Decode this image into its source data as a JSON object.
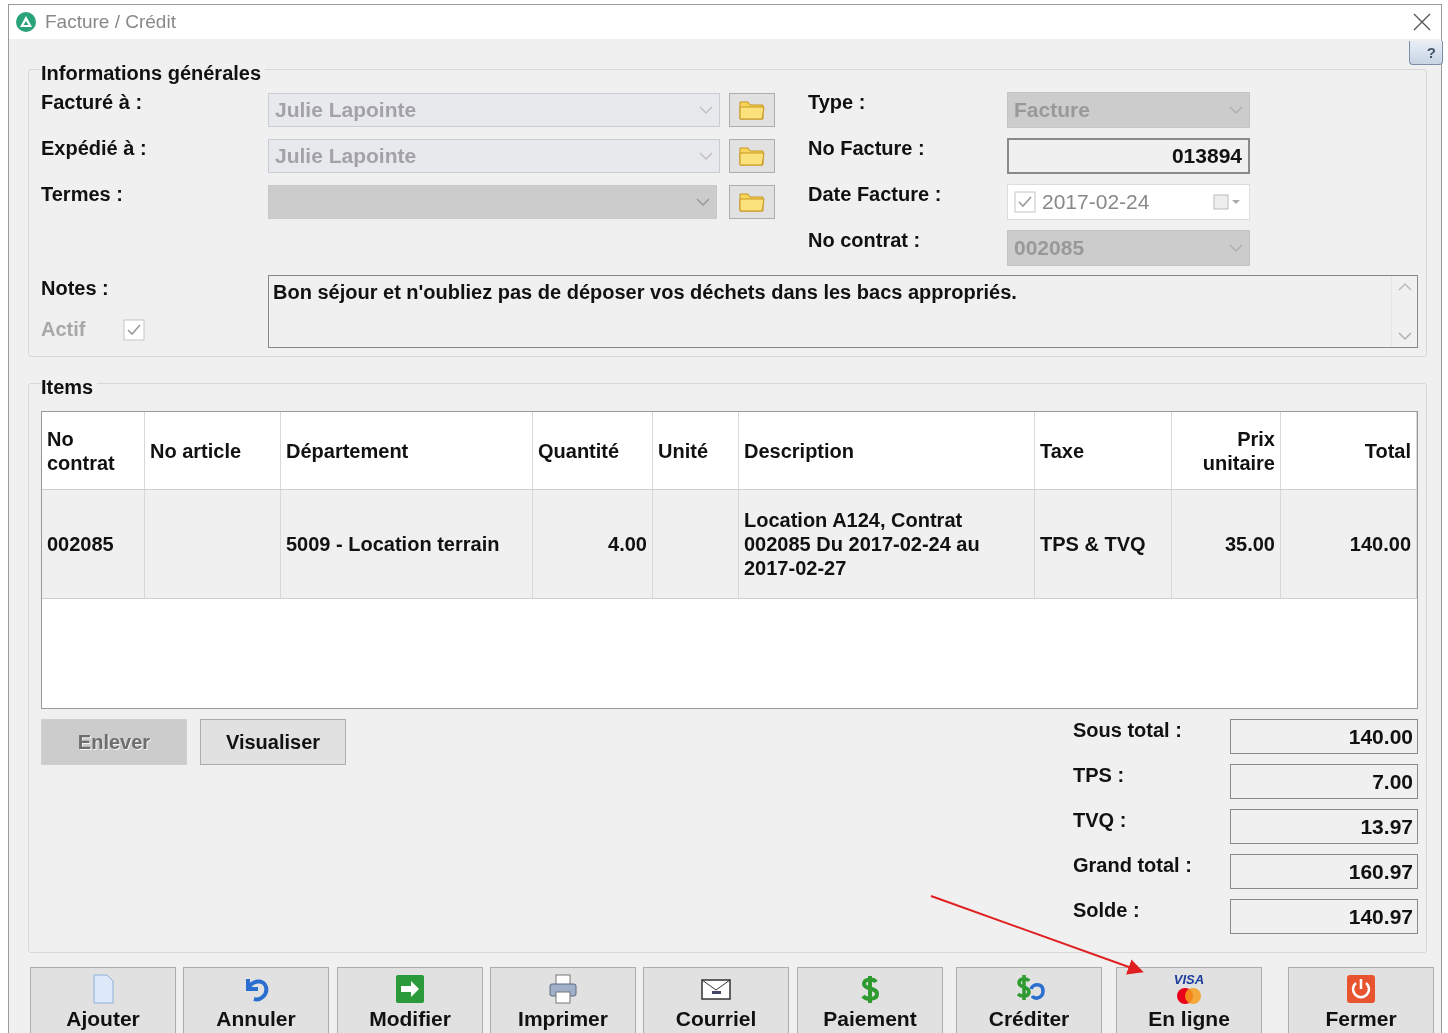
{
  "window": {
    "title": "Facture / Crédit",
    "help": "?"
  },
  "general": {
    "title": "Informations générales",
    "left_fields": [
      {
        "label": "Facturé à :",
        "value": "Julie Lapointe",
        "kind": "combo"
      },
      {
        "label": "Expédié à :",
        "value": "Julie Lapointe",
        "kind": "combo"
      },
      {
        "label": "Termes :",
        "kind": "disabled"
      }
    ],
    "right_fields": [
      {
        "label": "Type :",
        "value": "Facture",
        "kind": "disabled"
      },
      {
        "label": "No Facture :",
        "value": "013894",
        "kind": "text"
      },
      {
        "label": "Date Facture :",
        "value": "2017-02-24",
        "kind": "date",
        "checked": true
      },
      {
        "label": "No contrat :",
        "value": "002085",
        "kind": "disabled"
      }
    ],
    "notes": {
      "label": "Notes :",
      "value": "Bon séjour et n'oubliez pas de déposer vos déchets dans les bacs appropriés."
    },
    "active": {
      "label": "Actif",
      "checked": true,
      "disabled": true
    }
  },
  "items": {
    "title": "Items",
    "columns": [
      {
        "label": "No contrat",
        "kind": "text"
      },
      {
        "label": "No article",
        "kind": "text"
      },
      {
        "label": "Département",
        "kind": "text"
      },
      {
        "label": "Quantité",
        "kind": "number"
      },
      {
        "label": "Unité",
        "kind": "text"
      },
      {
        "label": "Description",
        "kind": "text"
      },
      {
        "label": "Taxe",
        "kind": "text"
      },
      {
        "label": "Prix unitaire",
        "kind": "amount"
      },
      {
        "label": "Total",
        "kind": "amount"
      }
    ],
    "rows": [
      {
        "cells": [
          "002085",
          "",
          "5009 - Location terrain",
          "4.00",
          "",
          "Location A124, Contrat 002085 Du 2017-02-24 au 2017-02-27",
          "TPS & TVQ",
          "35.00",
          "140.00"
        ]
      }
    ],
    "actions": [
      {
        "label": "Enlever",
        "disabled": true
      },
      {
        "label": "Visualiser",
        "disabled": false
      }
    ],
    "totals": [
      {
        "label": "Sous total :",
        "value": "140.00"
      },
      {
        "label": "TPS :",
        "value": "7.00"
      },
      {
        "label": "TVQ :",
        "value": "13.97"
      },
      {
        "label": "Grand total :",
        "value": "160.97"
      },
      {
        "label": "Solde :",
        "value": "140.97"
      }
    ]
  },
  "toolbar": [
    {
      "label": "Ajouter",
      "kind": "page"
    },
    {
      "label": "Annuler",
      "kind": "undo"
    },
    {
      "label": "Modifier",
      "kind": "arrow"
    },
    {
      "label": "Imprimer",
      "kind": "printer"
    },
    {
      "label": "Courriel",
      "kind": "mail"
    },
    {
      "label": "Paiement",
      "kind": "dollar"
    },
    {
      "label": "Créditer",
      "kind": "credit"
    },
    {
      "label": "En ligne",
      "kind": "card",
      "icon_text": "VISA"
    },
    {
      "label": "Fermer",
      "kind": "power"
    }
  ]
}
